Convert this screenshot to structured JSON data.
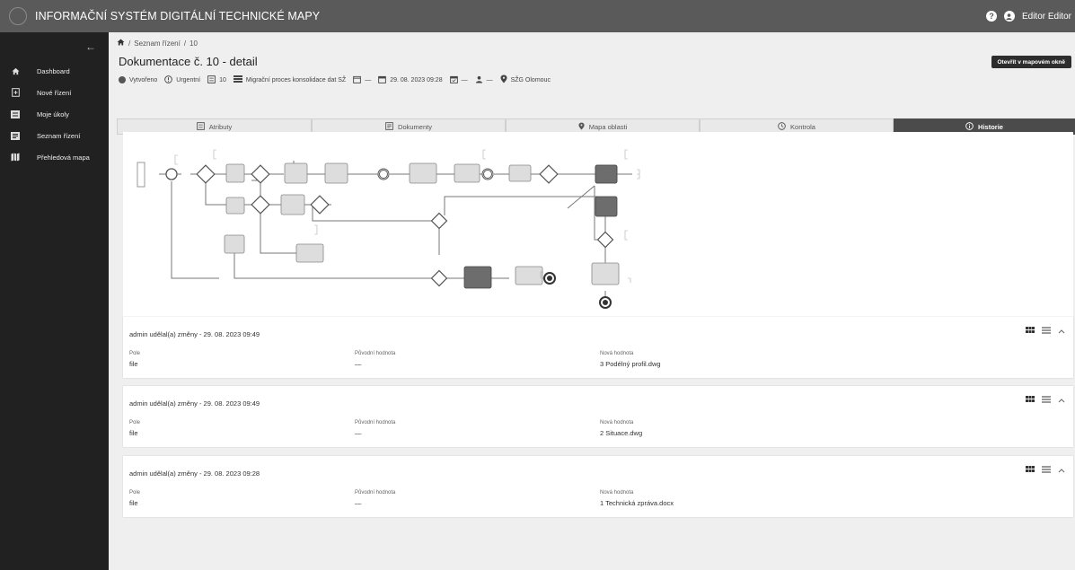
{
  "header": {
    "title": "INFORMAČNÍ SYSTÉM DIGITÁLNÍ TECHNICKÉ MAPY",
    "help_icon": "question-circle-icon",
    "user_icon": "account-circle-icon",
    "user_name": "Editor Editor"
  },
  "sidebar": {
    "collapse_icon": "arrow-left-icon",
    "items": [
      {
        "label": "Dashboard",
        "icon": "home-icon"
      },
      {
        "label": "Nové řízení",
        "icon": "document-plus-icon"
      },
      {
        "label": "Moje úkoly",
        "icon": "task-list-icon"
      },
      {
        "label": "Seznam řízení",
        "icon": "list-box-icon"
      },
      {
        "label": "Přehledová mapa",
        "icon": "map-icon"
      }
    ]
  },
  "breadcrumb": {
    "home_icon": "home-icon",
    "parts": [
      "/",
      "Seznam řízení",
      "/",
      "10"
    ]
  },
  "page": {
    "title": "Dokumentace č. 10 - detail",
    "open_map_button": "Otevřít v mapovém okně"
  },
  "meta": {
    "status": "Vytvořeno",
    "priority": "Urgentní",
    "number": "10",
    "process": "Migrační proces konsolidace dat SŽ",
    "date_empty": "—",
    "datetime": "29. 08. 2023 09:28",
    "deadline_empty": "—",
    "user_empty": "—",
    "location": "SŽG Olomouc"
  },
  "tabs": [
    {
      "label": "Atributy",
      "icon": "list-icon"
    },
    {
      "label": "Dokumenty",
      "icon": "document-icon"
    },
    {
      "label": "Mapa oblasti",
      "icon": "map-marker-icon"
    },
    {
      "label": "Kontrola",
      "icon": "clock-icon"
    },
    {
      "label": "Historie",
      "icon": "info-icon",
      "active": true
    }
  ],
  "history": [
    {
      "header": "admin udělal(a) změny - 29. 08. 2023 09:49",
      "field_label": "Pole",
      "field_value": "file",
      "old_label": "Původní hodnota",
      "old_value": "—",
      "new_label": "Nová hodnota",
      "new_value": "3 Podélný profil.dwg"
    },
    {
      "header": "admin udělal(a) změny - 29. 08. 2023 09:49",
      "field_label": "Pole",
      "field_value": "file",
      "old_label": "Původní hodnota",
      "old_value": "—",
      "new_label": "Nová hodnota",
      "new_value": "2 Situace.dwg"
    },
    {
      "header": "admin udělal(a) změny - 29. 08. 2023 09:28",
      "field_label": "Pole",
      "field_value": "file",
      "old_label": "Původní hodnota",
      "old_value": "—",
      "new_label": "Nová hodnota",
      "new_value": "1 Technická zpráva.docx"
    }
  ]
}
